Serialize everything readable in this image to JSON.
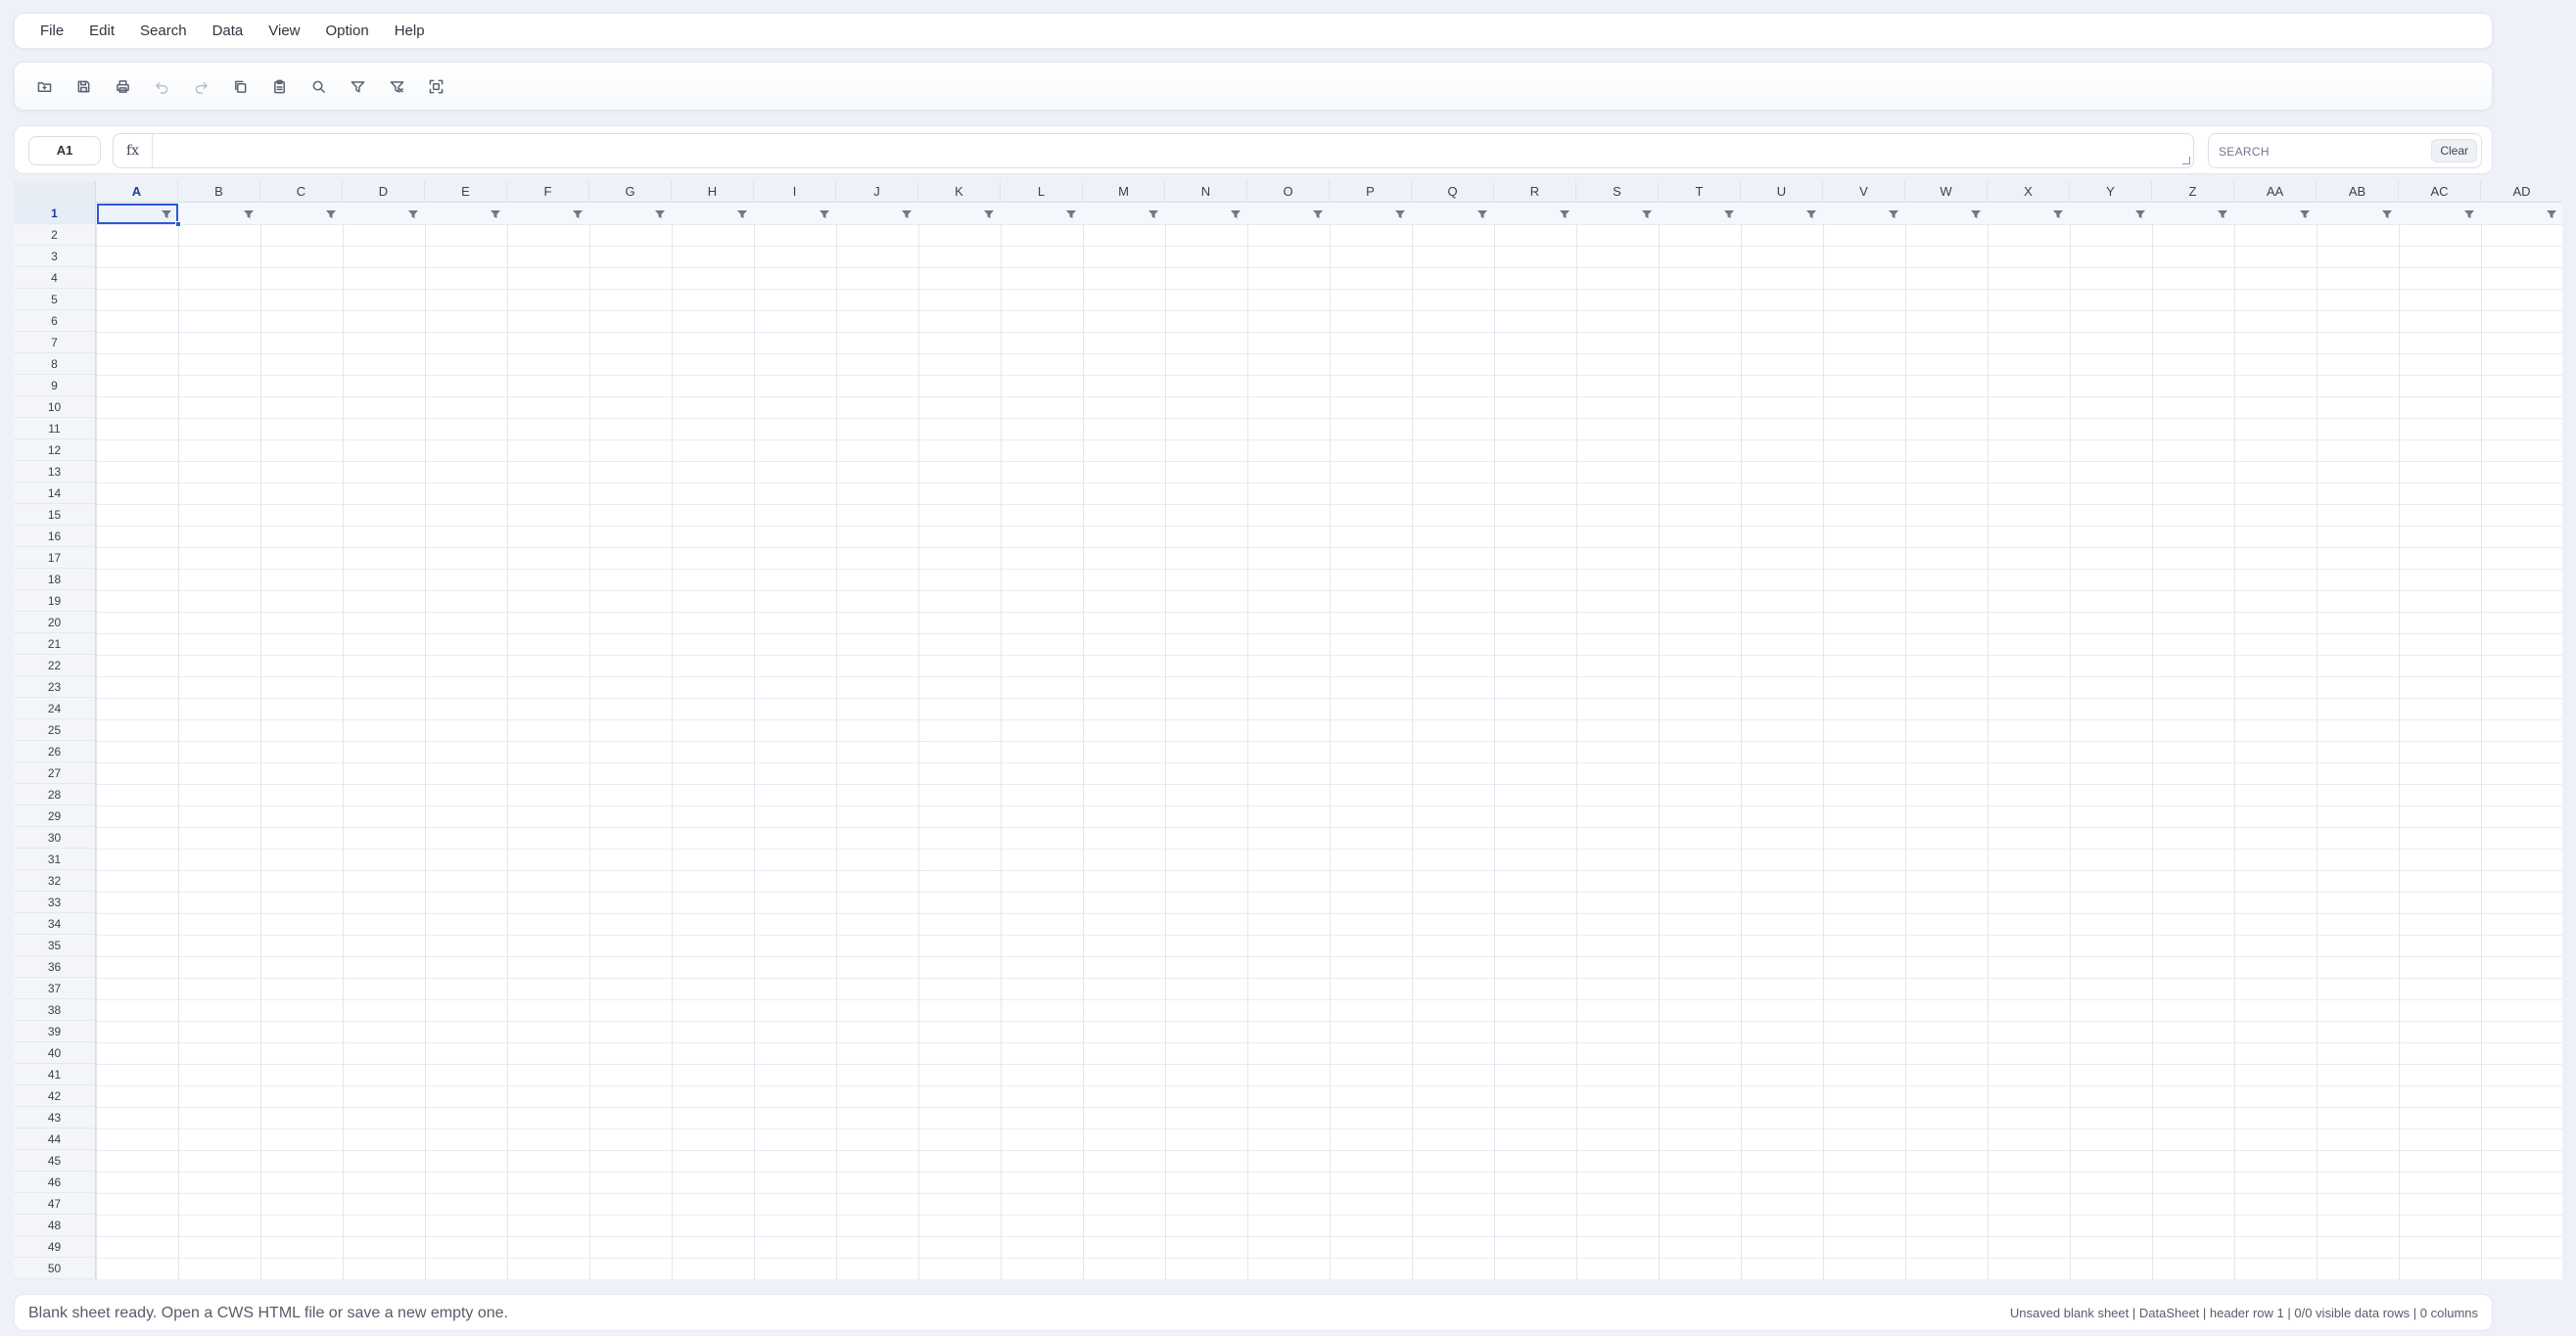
{
  "menu": [
    "File",
    "Edit",
    "Search",
    "Data",
    "View",
    "Option",
    "Help"
  ],
  "toolbar": {
    "tools": [
      {
        "icon": "open-folder-icon",
        "enabled": true
      },
      {
        "icon": "save-icon",
        "enabled": true
      },
      {
        "icon": "print-icon",
        "enabled": true
      },
      {
        "icon": "undo-icon",
        "enabled": false
      },
      {
        "icon": "redo-icon",
        "enabled": false
      },
      {
        "icon": "copy-icon",
        "enabled": true
      },
      {
        "icon": "paste-icon",
        "enabled": true
      },
      {
        "icon": "search-icon",
        "enabled": true
      },
      {
        "icon": "filter-icon",
        "enabled": true
      },
      {
        "icon": "filter-clear-icon",
        "enabled": true
      },
      {
        "icon": "fit-view-icon",
        "enabled": true
      }
    ]
  },
  "formula": {
    "name_box": "A1",
    "fx_label": "fx",
    "value": ""
  },
  "search": {
    "placeholder": "SEARCH",
    "clear_label": "Clear"
  },
  "grid": {
    "columns": [
      "A",
      "B",
      "C",
      "D",
      "E",
      "F",
      "G",
      "H",
      "I",
      "J",
      "K",
      "L",
      "M",
      "N",
      "O",
      "P",
      "Q",
      "R",
      "S",
      "T",
      "U",
      "V",
      "W",
      "X",
      "Y",
      "Z",
      "AA",
      "AB",
      "AC",
      "AD"
    ],
    "row_count": 50,
    "active_cell": {
      "column": "A",
      "row": 1
    },
    "colors": {
      "accent": "#2a5bd7"
    }
  },
  "status": {
    "left": "Blank sheet ready. Open a CWS HTML file or save a new empty one.",
    "right": "Unsaved blank sheet | DataSheet | header row 1 | 0/0 visible data rows | 0 columns"
  }
}
